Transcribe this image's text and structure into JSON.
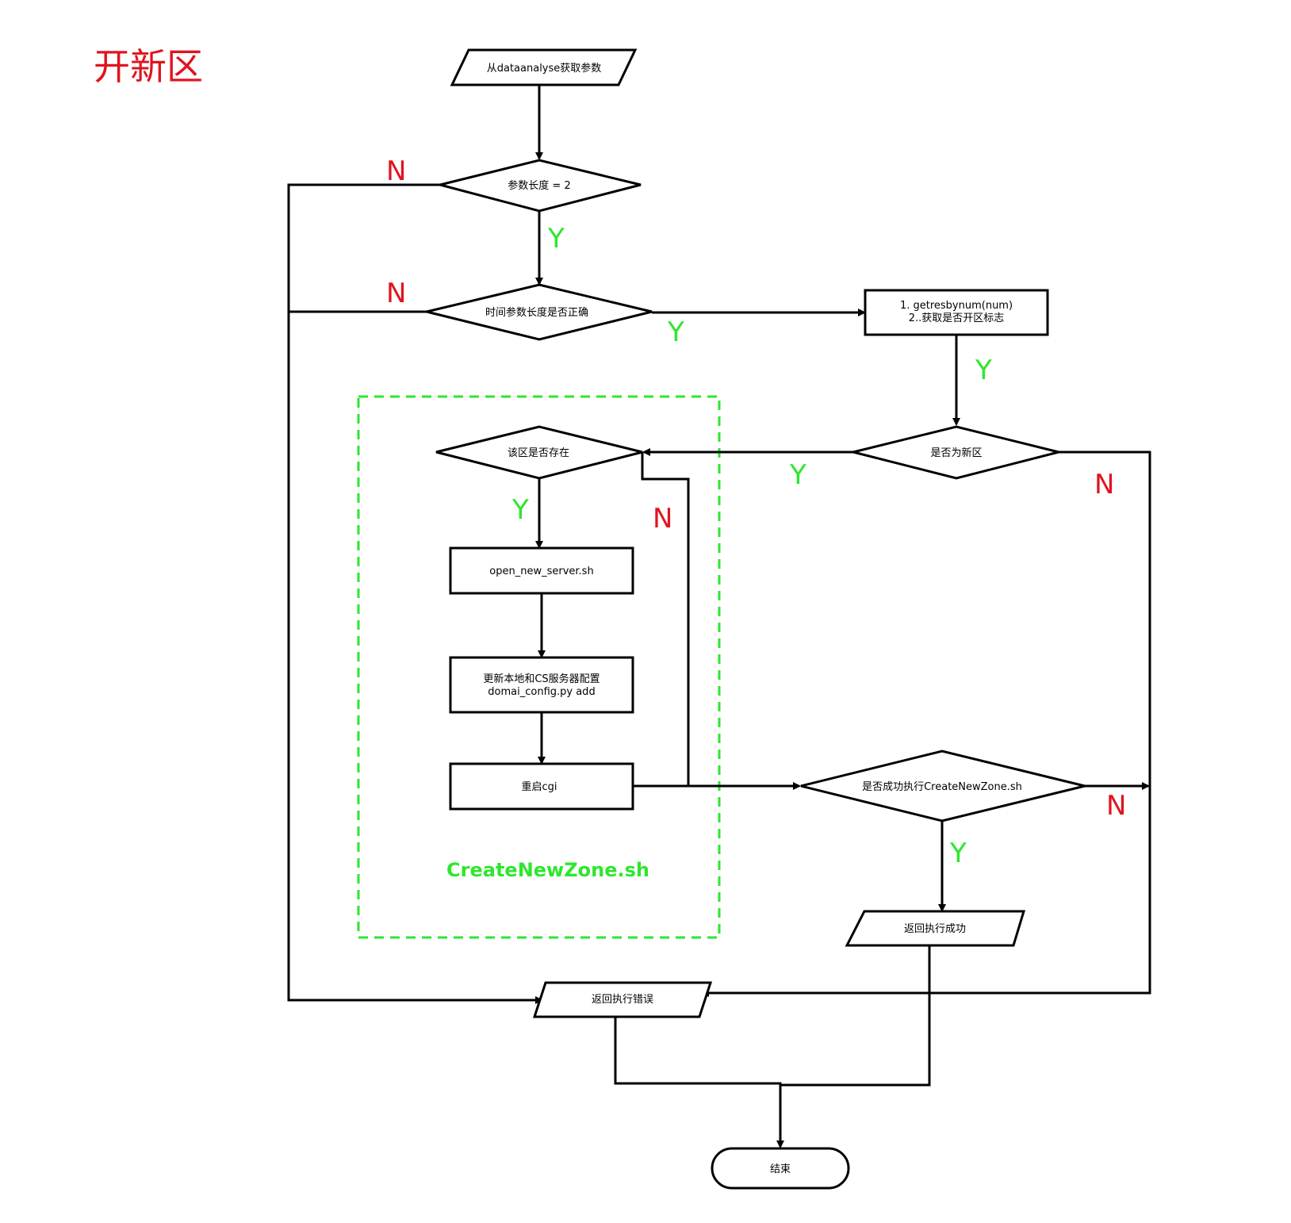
{
  "title": "开新区",
  "group_label": "CreateNewZone.sh",
  "nodes": {
    "get_params": "从dataanalyse获取参数",
    "param_len": "参数长度 = 2",
    "time_param": "时间参数长度是否正确",
    "getres_line1": "1. getresbynum(num)",
    "getres_line2": "2..获取是否开区标志",
    "is_new": "是否为新区",
    "zone_exists": "该区是否存在",
    "open_server": "open_new_server.sh",
    "update_line1": "更新本地和CS服务器配置",
    "update_line2": "domai_config.py add",
    "restart_cgi": "重启cgi",
    "exec_success": "是否成功执行CreateNewZone.sh",
    "return_success": "返回执行成功",
    "return_error": "返回执行错误",
    "end": "结束"
  },
  "edge_labels": {
    "param_len_n": "N",
    "param_len_y": "Y",
    "time_param_n": "N",
    "time_param_y": "Y",
    "getres_y": "Y",
    "is_new_y": "Y",
    "is_new_n": "N",
    "zone_exists_y": "Y",
    "zone_exists_n": "N",
    "exec_n": "N",
    "exec_y": "Y"
  },
  "colors": {
    "yes": "#2ee62e",
    "no": "#e0141e",
    "group": "#2ee62e",
    "line": "#000000"
  }
}
